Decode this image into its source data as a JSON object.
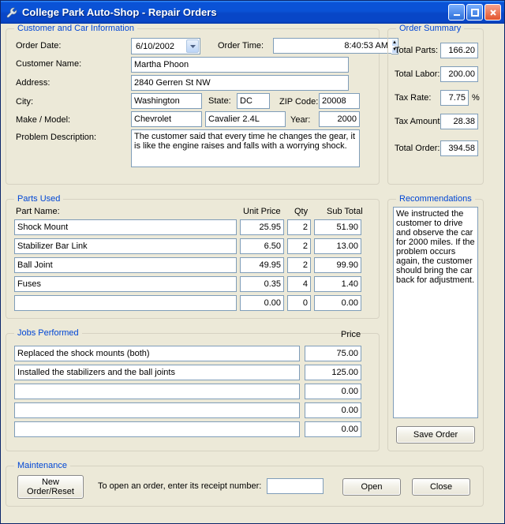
{
  "window": {
    "title": "College Park Auto-Shop - Repair Orders"
  },
  "customer": {
    "legend": "Customer and Car Information",
    "order_date_lbl": "Order Date:",
    "order_date": "6/10/2002",
    "order_time_lbl": "Order Time:",
    "order_time": "8:40:53 AM",
    "name_lbl": "Customer Name:",
    "name": "Martha Phoon",
    "address_lbl": "Address:",
    "address": "2840 Gerren St NW",
    "city_lbl": "City:",
    "city": "Washington",
    "state_lbl": "State:",
    "state": "DC",
    "zip_lbl": "ZIP Code:",
    "zip": "20008",
    "make_lbl": "Make / Model:",
    "make": "Chevrolet",
    "model": "Cavalier 2.4L",
    "year_lbl": "Year:",
    "year": "2000",
    "problem_lbl": "Problem Description:",
    "problem": "The customer said that every time he changes the gear, it is like the engine raises and falls with a worrying shock."
  },
  "summary": {
    "legend": "Order Summary",
    "total_parts_lbl": "Total Parts:",
    "total_parts": "166.20",
    "total_labor_lbl": "Total Labor:",
    "total_labor": "200.00",
    "tax_rate_lbl": "Tax Rate:",
    "tax_rate": "7.75",
    "tax_pct": "%",
    "tax_amount_lbl": "Tax Amount:",
    "tax_amount": "28.38",
    "total_order_lbl": "Total Order:",
    "total_order": "394.58"
  },
  "parts": {
    "legend": "Parts Used",
    "h_name": "Part Name:",
    "h_price": "Unit Price",
    "h_qty": "Qty",
    "h_sub": "Sub Total",
    "r0": {
      "name": "Shock Mount",
      "price": "25.95",
      "qty": "2",
      "sub": "51.90"
    },
    "r1": {
      "name": "Stabilizer Bar Link",
      "price": "6.50",
      "qty": "2",
      "sub": "13.00"
    },
    "r2": {
      "name": "Ball Joint",
      "price": "49.95",
      "qty": "2",
      "sub": "99.90"
    },
    "r3": {
      "name": "Fuses",
      "price": "0.35",
      "qty": "4",
      "sub": "1.40"
    },
    "r4": {
      "name": "",
      "price": "0.00",
      "qty": "0",
      "sub": "0.00"
    }
  },
  "jobs": {
    "legend": "Jobs Performed",
    "h_price": "Price",
    "r0": {
      "desc": "Replaced the shock mounts (both)",
      "price": "75.00"
    },
    "r1": {
      "desc": "Installed the stabilizers and the ball joints",
      "price": "125.00"
    },
    "r2": {
      "desc": "",
      "price": "0.00"
    },
    "r3": {
      "desc": "",
      "price": "0.00"
    },
    "r4": {
      "desc": "",
      "price": "0.00"
    }
  },
  "recs": {
    "legend": "Recommendations",
    "text": "We instructed the customer to drive and observe the car for 2000 miles. If the problem occurs again, the customer should bring the car back for adjustment.",
    "save": "Save Order"
  },
  "maint": {
    "legend": "Maintenance",
    "new": "New Order/Reset",
    "hint": "To open an order,  enter its receipt number:",
    "receipt": "",
    "open": "Open",
    "close": "Close"
  }
}
